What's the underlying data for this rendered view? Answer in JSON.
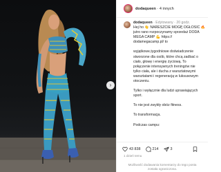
{
  "header": {
    "username": "dodaqueen",
    "separator": "·",
    "others": "4 innych"
  },
  "caption": {
    "username": "dodaqueen",
    "edited": "Edytowany",
    "age": "20 godz.",
    "paragraphs": [
      [
        "Hej ho 👋 NARESZCIE MOGĘ OGŁOSIĆ 🔥",
        "jutro rano rozpoczynamy sprzedaż DODA",
        "MEGA CAMP 💪 https://",
        "dodamegacamp.pl/ to"
      ],
      [
        "wyjątkowe,tygodniowe  doświadczenie",
        "stworzone dla osób, które chcą zadbać o",
        "ciało, głowę i energię życiową. To",
        "połączenie intensywnych treningów nie",
        "tylko ciała, ale i ducha z warsztatowymi",
        "warsztatami i regeneracją w luksusowym",
        "otoczeniu."
      ],
      [
        "Tylko i wyłącznie dla ludzi uprawiających",
        "sport."
      ],
      [
        "To nie jest zwykły obóz fitness."
      ],
      [
        "To transformacja."
      ],
      [
        "Podczas campu:"
      ]
    ]
  },
  "stats": {
    "likes": "43 838",
    "comments": "214",
    "shares": "3"
  },
  "date": "1 dzień temu",
  "restricted_notice": "Możliwość dodawania komentarzy do tego posta została ograniczona.",
  "colors": {
    "divider": "#efefef",
    "muted": "#8e8e8e",
    "text": "#262626",
    "story_ring": "#e1306c"
  },
  "icons": {
    "like": "heart-icon",
    "comment": "comment-icon",
    "share": "share-icon",
    "save": "bookmark-icon",
    "next": "chevron-right-icon"
  }
}
